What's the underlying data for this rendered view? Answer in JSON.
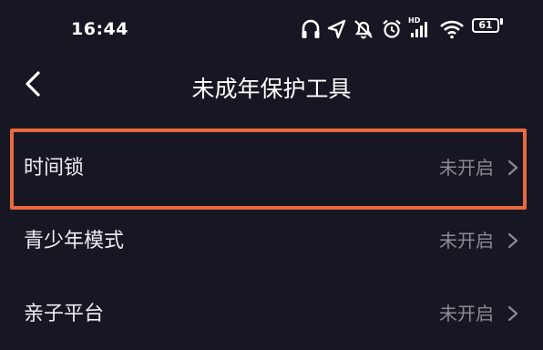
{
  "status_bar": {
    "time": "16:44",
    "battery_level": "61",
    "icons": [
      "headset-icon",
      "location-arrow-icon",
      "mute-icon",
      "alarm-icon",
      "hd-signal-icon",
      "wifi-icon",
      "battery-icon"
    ],
    "hd_label": "HD"
  },
  "nav": {
    "title": "未成年保护工具",
    "back_icon": "chevron-left-icon"
  },
  "settings": {
    "items": [
      {
        "label": "时间锁",
        "value": "未开启"
      },
      {
        "label": "青少年模式",
        "value": "未开启"
      },
      {
        "label": "亲子平台",
        "value": "未开启"
      }
    ]
  },
  "colors": {
    "background": "#161722",
    "highlight": "#e8693f",
    "secondary_text": "#8a8b93"
  }
}
